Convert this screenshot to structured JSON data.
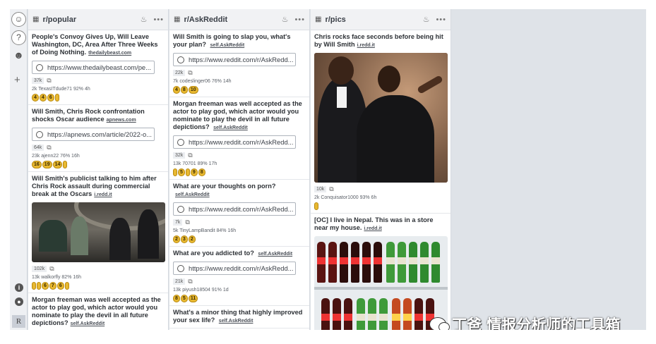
{
  "columns": [
    {
      "subreddit": "r/popular",
      "posts": [
        {
          "title": "People's Convoy Gives Up, Will Leave Washington, DC, Area After Three Weeks of Doing Nothing.",
          "domain": "thedailybeast.com",
          "link": "https://www.thedailybeast.com/pe...",
          "score": "37k",
          "meta": "2k  TexasITdude71  92%  4h",
          "awards": [
            "4",
            "4",
            "6",
            ""
          ]
        },
        {
          "title": "Will Smith, Chris Rock confrontation shocks Oscar audience",
          "domain": "apnews.com",
          "link": "https://apnews.com/article/2022-o...",
          "score": "64k",
          "meta": "23k  ajenn22  76%  16h",
          "awards": [
            "16",
            "19",
            "14",
            ""
          ]
        },
        {
          "title": "Will Smith's publicist talking to him after Chris Rock assault during commercial break at the Oscars",
          "domain": "i.redd.it",
          "score": "102k",
          "meta": "13k  walkorfly  82%  16h",
          "awards": [
            "",
            "",
            "6",
            "7",
            "6",
            ""
          ]
        },
        {
          "title": "Morgan freeman was well accepted as the actor to play god, which actor would you nominate to play the devil in all future depictions?",
          "domain": "self.AskReddit"
        }
      ]
    },
    {
      "subreddit": "r/AskReddit",
      "posts": [
        {
          "title": "Will Smith is going to slap you, what's your plan?",
          "domain": "self.AskReddit",
          "link": "https://www.reddit.com/r/AskRedd...",
          "score": "22k",
          "meta": "7k  codeslinger06  76%  14h",
          "awards": [
            "4",
            "8",
            "10"
          ]
        },
        {
          "title": "Morgan freeman was well accepted as the actor to play god, which actor would you nominate to play the devil in all future depictions?",
          "domain": "self.AskReddit",
          "link": "https://www.reddit.com/r/AskRedd...",
          "score": "32k",
          "meta": "13k  70701  89%  17h",
          "awards": [
            "",
            "5",
            "",
            "9",
            "8"
          ]
        },
        {
          "title": "What are your thoughts on porn?",
          "domain": "self.AskReddit",
          "link": "https://www.reddit.com/r/AskRedd...",
          "score": "7k",
          "meta": "5k  TinyLampBandit  84%  16h",
          "awards": [
            "2",
            "3",
            "2"
          ]
        },
        {
          "title": "What are you addicted to?",
          "domain": "self.AskReddit",
          "link": "https://www.reddit.com/r/AskRedd...",
          "score": "21k",
          "meta": "13k  piyush18504  91%  1d",
          "awards": [
            "8",
            "5",
            "11"
          ]
        },
        {
          "title": "What's a minor thing that highly improved your sex life?",
          "domain": "self.AskReddit"
        }
      ]
    },
    {
      "subreddit": "r/pics",
      "posts": [
        {
          "title": "Chris rocks face seconds before being hit by Will Smith",
          "domain": "i.redd.it",
          "score": "10k",
          "meta": "2k  Conquisator1000  93%  6h",
          "awards": [
            ""
          ]
        },
        {
          "title": "[OC] I live in Nepal. This was in a store near my house.",
          "domain": "i.redd.it"
        }
      ]
    }
  ],
  "rail": {
    "r_label": "R"
  },
  "watermark": "丁爸 情报分析师的工具箱",
  "colors": {
    "award_gold": "#e8b830",
    "frame_bg": "#dfe3e8"
  }
}
